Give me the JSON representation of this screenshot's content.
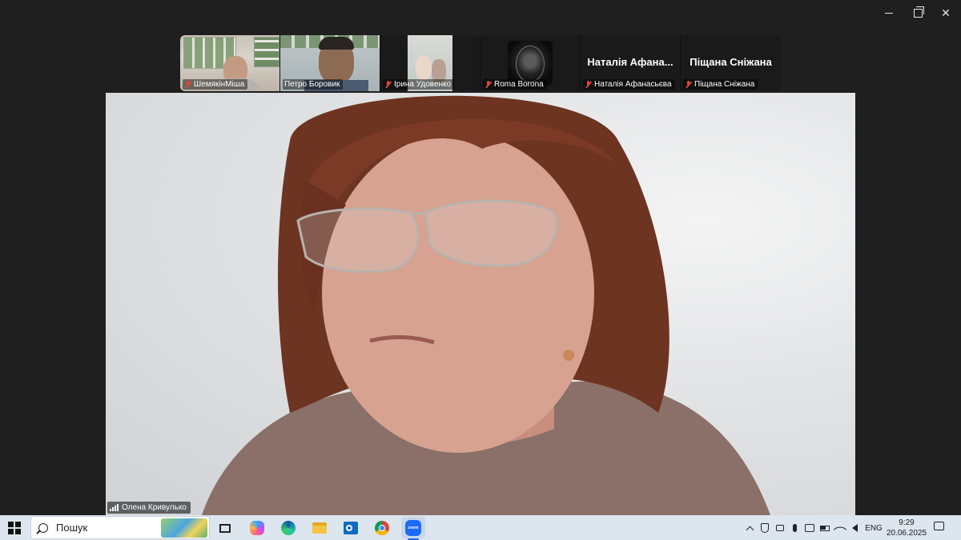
{
  "window": {
    "controls": [
      "minimize",
      "restore",
      "close"
    ]
  },
  "participants": [
    {
      "name": "ШемякінМіша",
      "muted": true,
      "video": true
    },
    {
      "name": "Петро Боровик",
      "muted": false,
      "video": true
    },
    {
      "name": "Ірина Удовенко",
      "muted": true,
      "video": true
    },
    {
      "name": "Roma Borona",
      "muted": true,
      "video": false
    },
    {
      "name": "Наталія Афанасьєва",
      "display_name": "Наталія Афана...",
      "muted": true,
      "video": false
    },
    {
      "name": "Піщана Сніжана",
      "display_name": "Піщана Сніжана",
      "muted": true,
      "video": false
    }
  ],
  "speaker": {
    "name": "Олена Кривулько"
  },
  "taskbar": {
    "search_placeholder": "Пошук",
    "apps": [
      "task-view",
      "copilot",
      "edge",
      "file-explorer",
      "outlook",
      "chrome",
      "zoom"
    ],
    "language": "ENG",
    "time": "9:29",
    "date": "20.06.2025"
  },
  "colors": {
    "mute_red": "#e0463a",
    "taskbar_bg": "#dde6ef",
    "zoom_blue": "#1b6bff"
  }
}
